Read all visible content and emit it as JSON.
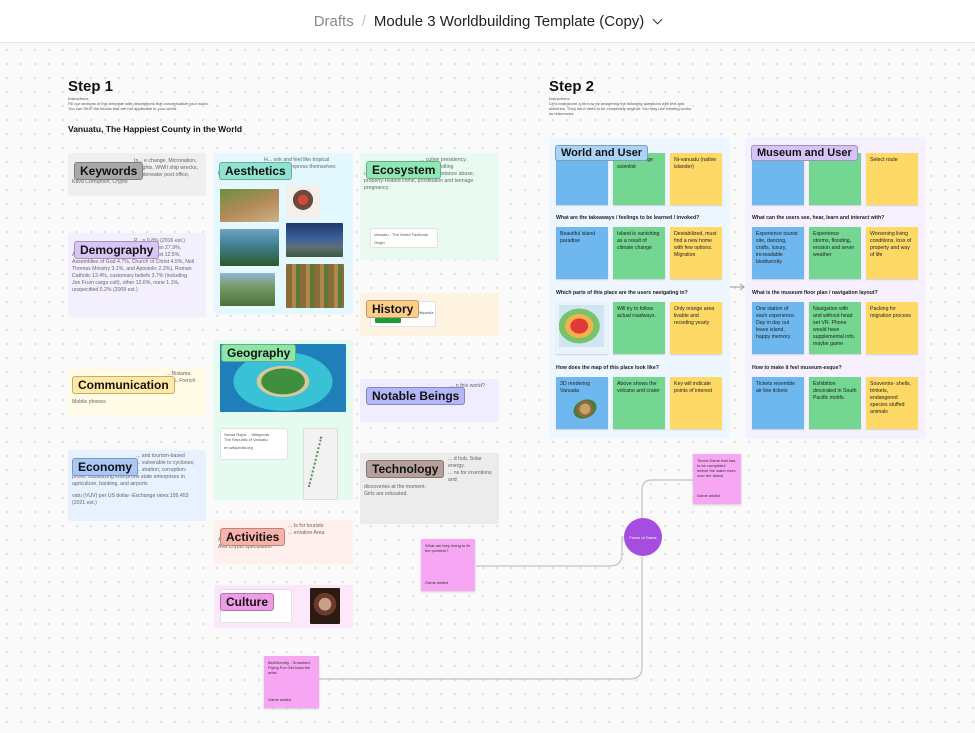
{
  "header": {
    "drafts": "Drafts",
    "separator": "/",
    "doc_title": "Module 3 Worldbuilding Template (Copy)"
  },
  "step1": {
    "title": "Step 1",
    "instr_label": "Instructions",
    "instr_line1": "Fill our sections of this template with descriptions that conceptualize your world.",
    "instr_line2": "You can SKIP the blocks that are not applicable to your world.",
    "subtitle": "Vanuatu, The Happiest County in the World"
  },
  "step2": {
    "title": "Step 2",
    "instr_label": "Instructions",
    "instr_line1": "Let's brainstorm a bit now by answering the following questions with text and",
    "instr_line2": "sketches. They don't need to be completely original. You may use existing works",
    "instr_line3": "as references."
  },
  "cards": {
    "keywords": {
      "tag": "Keywords",
      "l1": "In... e change, Micronation,",
      "l2": "P... ghts, WWII ship wrecks,",
      "l3": "... nderwater post office,",
      "l4": "Kava Corruption, Crypto"
    },
    "demography": {
      "tag": "Demography",
      "l1": "P... n 0.8% (2016 est.)",
      "l2": "P... sbyterian 27.9%,",
      "l3": "Anglican 15.1%, Seventh Day Adventist 12.5%,",
      "l4": "Assemblies of God 4.7%, Church of Christ 4.5%, Neil",
      "l5": "Thomas Ministry 3.1%, and Apostolic 2.2%), Roman",
      "l6": "Catholic 12.4%, customary beliefs 3.7% (including",
      "l7": "Jon Frum cargo cult), other 12.6%, none 1.1%,",
      "l8": "unspecified 0.2% (2009 est.)"
    },
    "communication": {
      "tag": "Communication",
      "l1": "... Bislama",
      "l2": "... %, French",
      "l3": "Mobile phones"
    },
    "economy": {
      "tag": "Economy",
      "l1": "... and tourism-based",
      "l2": "... vulnerable to cyclones;",
      "l3": "... stration; corruption-",
      "l4": "prone; subsidizing loss-prone state enterprises in",
      "l5": "agriculture, banking, and airports",
      "l6": "vatu (VUV) per US dollar -Exchange rates:109.453",
      "l7": "(2021 est.)"
    },
    "aesthetics": {
      "tag": "Aesthetics",
      "l1": "H... ook and feel like tropical",
      "l2": "... express themselves",
      "l3": "Rom dance?"
    },
    "geography": {
      "tag": "Geography",
      "link1": "Vanua Rapa ... Wikipedia",
      "link2": "The Republic of Vanuatu",
      "link3": "en.wikipedia.org"
    },
    "activities": {
      "tag": "Activities",
      "l1": "... ts for tourists",
      "l2": "... ervation Area",
      "l3": "All water sports?",
      "l4": "And Crypto speculation"
    },
    "culture": {
      "tag": "Culture"
    },
    "ecosystem": {
      "tag": "Ecosystem",
      "l1": "... cutive presidency.",
      "l2": "... handling",
      "l3": "unemployment contributing to substance abuse,",
      "l4": "property-related crime, prostitution and teenage",
      "l5": "pregnancy.",
      "link": "Vanuatu - The World Factbook",
      "link2": "Origin"
    },
    "history": {
      "tag": "History",
      "link": "... Wikipedia"
    },
    "notable": {
      "tag": "Notable Beings",
      "l1": "... n this world?"
    },
    "technology": {
      "tag": "Technology",
      "l1": "... d hub, Solar energy.",
      "l2": "... ns for inventions and",
      "l3": "discoveries at the moment.",
      "l4": "Girls are educated."
    }
  },
  "world": {
    "header": "World and User",
    "top": [
      "Tourist",
      "Climate change scientist",
      "Ni-vanuatu (native islander)"
    ],
    "q1": "What are the takeaways / feelings to be learned / invoked?",
    "r1": [
      "Beautiful island paradise",
      "Island is vanishing as a result of climate change",
      "Destabilized, must find a new home with few options. Migration"
    ],
    "q2": "Which parts of this place are the users navigating in?",
    "r2": [
      "",
      "Will try to follow actual roadways.",
      "Only orange area livable and receding yearly"
    ],
    "q3": "How does the map of this place look like?",
    "r3": [
      "3D rendering Vanuata",
      "Above shows the volcano and crater",
      "Key will indicate points of interest"
    ]
  },
  "museum": {
    "header": "Museum and User",
    "top": [
      "",
      "",
      "Select route"
    ],
    "q1": "What can the users see, hear, learn and interact with?",
    "r1": [
      "Experience tourist site, dancing, crafts, luxury, increadable biodiversity",
      "Experience storms, flooding, erosion and sever weather",
      "Worsening living conditions, loss of property and way of life"
    ],
    "q2": "What is the museum floor plan / navigation layout?",
    "r2": [
      "One station of each experience. Day in day out leave island, happy memory",
      "Navigation with and without head set VR. Phone would have supplemental info, maybe game",
      "Packing for migration process"
    ],
    "q3": "How to make it feel museum-esque?",
    "r3": [
      "Tickets resemble air line tickets",
      "Exhibition decorated in South Pacific motifs.",
      "Souvenirs- shells, trinkets, endangered species stuffed animals"
    ]
  },
  "canvas_notes": {
    "focus": "Focus of Game",
    "note1": "Timed Game that has to be completed before the water rises over the island",
    "note1_foot": "Game added",
    "note2": "What are they doing to fix the problem?",
    "note2_foot": "Game added",
    "note3": "BioDiversity - Smashed. Flying Fox Get back the artist",
    "note3_foot": "Game added"
  },
  "colors": {
    "yellow": "#ffd966",
    "blue": "#6fb8ef",
    "green": "#73d691",
    "pink": "#f6a6f2",
    "purple": "#a44de0"
  }
}
